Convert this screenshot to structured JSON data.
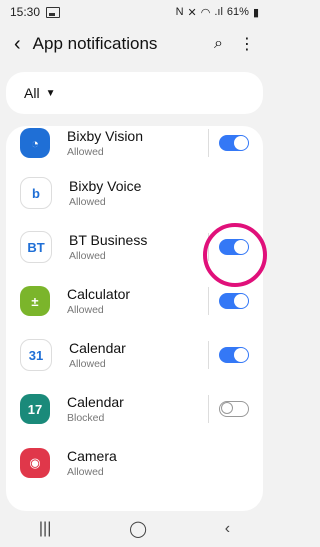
{
  "status_bar": {
    "time": "15:30",
    "battery": "61%"
  },
  "header": {
    "title": "App notifications",
    "back_icon": "back-arrow-icon",
    "search_icon": "search-icon",
    "more_icon": "more-vertical-icon"
  },
  "filter": {
    "selected": "All"
  },
  "apps": [
    {
      "name": "Bixby Vision",
      "status": "Allowed",
      "icon": "bixby-vision-icon",
      "color": "#1f6fd6",
      "glyph": "◔",
      "toggle": "on"
    },
    {
      "name": "Bixby Voice",
      "status": "Allowed",
      "icon": "bixby-voice-icon",
      "color": "#ffffff",
      "glyph": "b",
      "toggle": "none"
    },
    {
      "name": "BT Business",
      "status": "Allowed",
      "icon": "bt-icon",
      "color": "#ffffff",
      "glyph": "BT",
      "toggle": "on"
    },
    {
      "name": "Calculator",
      "status": "Allowed",
      "icon": "calculator-icon",
      "color": "#7bb52b",
      "glyph": "±",
      "toggle": "on"
    },
    {
      "name": "Calendar",
      "status": "Allowed",
      "icon": "calendar-icon",
      "color": "#ffffff",
      "glyph": "31",
      "toggle": "on"
    },
    {
      "name": "Calendar",
      "status": "Blocked",
      "icon": "calendar-icon-2",
      "color": "#1a8a7a",
      "glyph": "17",
      "toggle": "off"
    },
    {
      "name": "Camera",
      "status": "Allowed",
      "icon": "camera-icon",
      "color": "#e0374a",
      "glyph": "◉",
      "toggle": "none"
    }
  ],
  "nav": {
    "recents": "|||",
    "home": "◯",
    "back": "‹"
  }
}
